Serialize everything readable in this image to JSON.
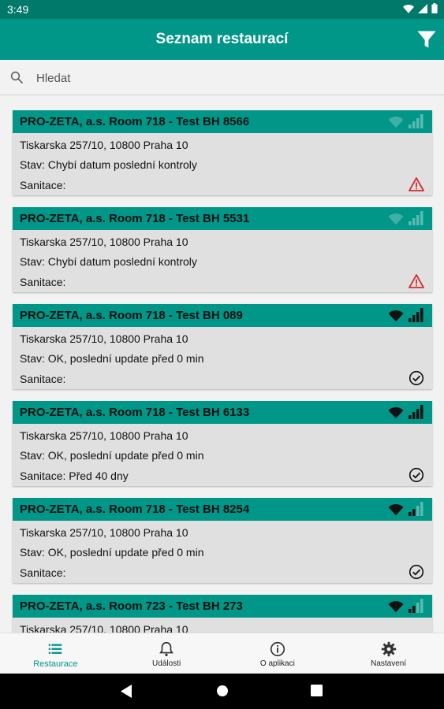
{
  "status_bar": {
    "time": "3:49",
    "icons": [
      "wifi-icon",
      "signal-icon",
      "battery-icon"
    ]
  },
  "app_bar": {
    "title": "Seznam restaurací",
    "filter_icon": "filter-icon"
  },
  "search": {
    "placeholder": "Hledat",
    "value": ""
  },
  "colors": {
    "primary": "#009688",
    "primary_dark": "#00796b",
    "card_bg": "#e0e0e0",
    "warning": "#d32f2f"
  },
  "restaurants": [
    {
      "name": "PRO-ZETA, a.s. Room 718 - Test BH 8566",
      "address": "Tiskarska 257/10, 10800 Praha 10",
      "state": "Stav: Chybí datum poslední kontroly",
      "sanitation": "Sanitace:",
      "status": "warning",
      "connection": "offline"
    },
    {
      "name": "PRO-ZETA, a.s. Room 718 - Test BH 5531",
      "address": "Tiskarska 257/10, 10800 Praha 10",
      "state": "Stav: Chybí datum poslední kontroly",
      "sanitation": "Sanitace:",
      "status": "warning",
      "connection": "offline"
    },
    {
      "name": "PRO-ZETA, a.s. Room 718 - Test BH 089",
      "address": "Tiskarska 257/10, 10800 Praha 10",
      "state": "Stav: OK, poslední update před 0 min",
      "sanitation": "Sanitace:",
      "status": "ok",
      "connection": "online"
    },
    {
      "name": "PRO-ZETA, a.s. Room 718 - Test BH 6133",
      "address": "Tiskarska 257/10, 10800 Praha 10",
      "state": "Stav: OK, poslední update před 0 min",
      "sanitation": "Sanitace: Před 40 dny",
      "status": "ok",
      "connection": "online"
    },
    {
      "name": "PRO-ZETA, a.s. Room 718 - Test BH 8254",
      "address": "Tiskarska 257/10, 10800 Praha 10",
      "state": "Stav: OK, poslední update před 0 min",
      "sanitation": "Sanitace:",
      "status": "ok",
      "connection": "weak"
    },
    {
      "name": "PRO-ZETA, a.s. Room 723 - Test BH 273",
      "address": "Tiskarska 257/10, 10800 Praha 10",
      "state": "",
      "sanitation": "",
      "status": "ok",
      "connection": "weak"
    }
  ],
  "bottom_nav": [
    {
      "label": "Restaurace",
      "icon": "list-icon",
      "active": true
    },
    {
      "label": "Události",
      "icon": "bell-icon",
      "active": false
    },
    {
      "label": "O aplikaci",
      "icon": "info-icon",
      "active": false
    },
    {
      "label": "Nastavení",
      "icon": "gear-icon",
      "active": false
    }
  ]
}
